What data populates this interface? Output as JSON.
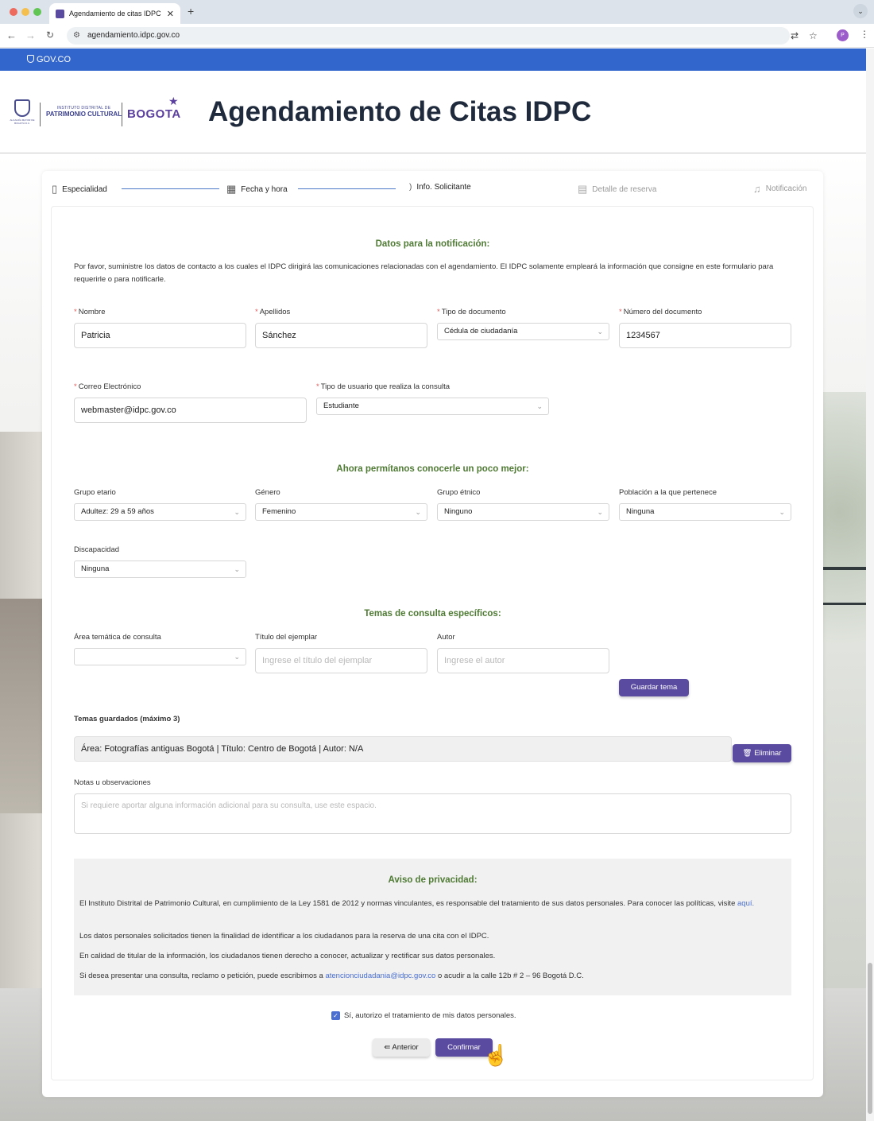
{
  "browser": {
    "tab_title": "Agendamiento de citas IDPC",
    "url": "agendamiento.idpc.gov.co",
    "profile_initial": "P"
  },
  "govbar": {
    "label": "GOV.CO"
  },
  "header": {
    "logo_line1": "INSTITUTO DISTRITAL DE",
    "logo_line2": "PATRIMONIO CULTURAL",
    "logo_bogota": "BOGOTA",
    "crest_text": "ALCALDÍA MAYOR DE BOGOTÁ D.C.",
    "title": "Agendamiento de Citas IDPC"
  },
  "steps": [
    {
      "label": "Especialidad",
      "icon": "bookmark-icon"
    },
    {
      "label": "Fecha y hora",
      "icon": "calendar-icon"
    },
    {
      "label": "Info. Solicitante",
      "icon": "spinner-icon"
    },
    {
      "label": "Detalle de reserva",
      "icon": "document-icon"
    },
    {
      "label": "Notificación",
      "icon": "bell-icon"
    }
  ],
  "notification": {
    "title": "Datos para la notificación:",
    "intro": "Por favor, suministre los datos de contacto a los cuales el IDPC dirigirá las comunicaciones relacionadas con el agendamiento. El IDPC solamente empleará la información que consigne en este formulario para requerirle o para notificarle.",
    "fields": {
      "nombre_label": "Nombre",
      "nombre_value": "Patricia",
      "apellidos_label": "Apellidos",
      "apellidos_value": "Sánchez",
      "tipo_doc_label": "Tipo de documento",
      "tipo_doc_value": "Cédula de ciudadanía",
      "numero_doc_label": "Número del documento",
      "numero_doc_value": "1234567",
      "correo_label": "Correo Electrónico",
      "correo_value": "webmaster@idpc.gov.co",
      "tipo_usuario_label": "Tipo de usuario que realiza la consulta",
      "tipo_usuario_value": "Estudiante"
    }
  },
  "about": {
    "title": "Ahora permítanos conocerle un poco mejor:",
    "grupo_etario_label": "Grupo etario",
    "grupo_etario_value": "Adultez: 29 a 59 años",
    "genero_label": "Género",
    "genero_value": "Femenino",
    "grupo_etnico_label": "Grupo étnico",
    "grupo_etnico_value": "Ninguno",
    "poblacion_label": "Población a la que pertenece",
    "poblacion_value": "Ninguna",
    "discapacidad_label": "Discapacidad",
    "discapacidad_value": "Ninguna"
  },
  "topics": {
    "title": "Temas de consulta específicos:",
    "area_label": "Área temática de consulta",
    "area_value": "",
    "titulo_label": "Título del ejemplar",
    "titulo_placeholder": "Ingrese el título del ejemplar",
    "autor_label": "Autor",
    "autor_placeholder": "Ingrese el autor",
    "save_button": "Guardar tema",
    "saved_title": "Temas guardados (máximo 3)",
    "saved_item": "Área: Fotografías antiguas Bogotá | Título: Centro de Bogotá  | Autor: N/A",
    "delete_button": "Eliminar",
    "notes_label": "Notas u observaciones",
    "notes_placeholder": "Si requiere aportar alguna información adicional para su consulta, use este espacio."
  },
  "privacy": {
    "title": "Aviso de privacidad:",
    "p1": "El Instituto Distrital de Patrimonio Cultural, en cumplimiento de la Ley 1581 de 2012 y normas vinculantes, es responsable del tratamiento de sus datos personales. Para conocer las políticas, visite",
    "p1_link": "aquí.",
    "p2": "Los datos personales solicitados tienen la finalidad de identificar a los ciudadanos para la reserva de una cita con el IDPC.",
    "p3": "En calidad de titular de la información, los ciudadanos tienen derecho a conocer, actualizar y rectificar sus datos personales.",
    "p4_pre": "Si desea presentar una consulta, reclamo o petición, puede escribirnos a",
    "p4_email": "atencionciudadania@idpc.gov.co",
    "p4_post": "o acudir a la calle 12b # 2 – 96 Bogotá D.C.",
    "consent": "Sí, autorizo el tratamiento de mis datos personales."
  },
  "actions": {
    "prev": "Anterior",
    "confirm": "Confirmar"
  },
  "colors": {
    "gov_blue": "#3366cc",
    "brand_purple": "#5a4aa0",
    "section_green": "#4e7a33"
  }
}
